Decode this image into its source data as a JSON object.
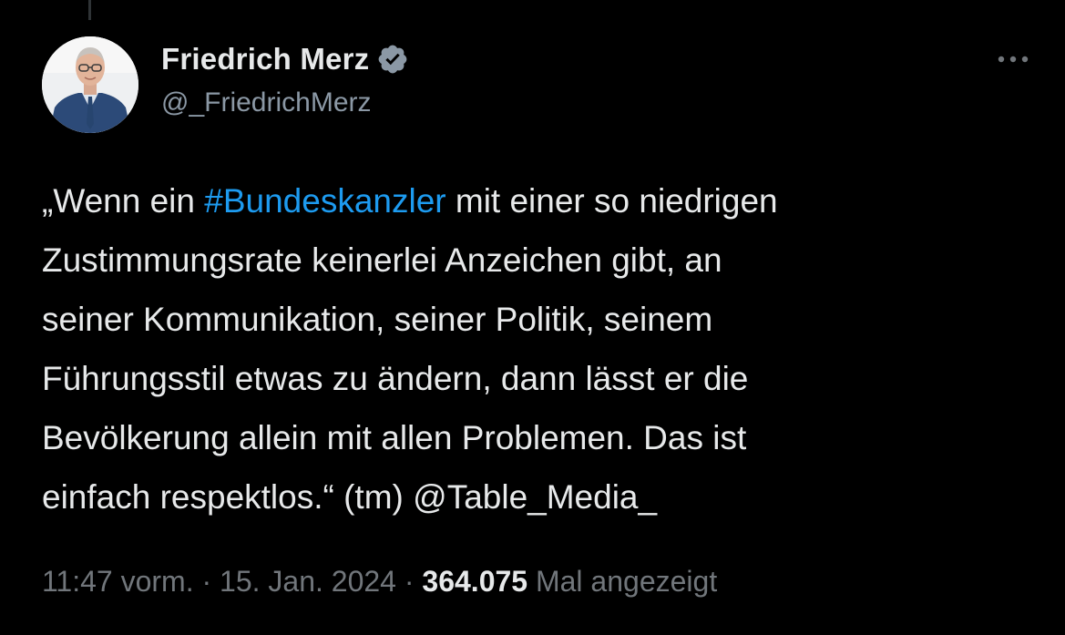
{
  "author": {
    "display_name": "Friedrich Merz",
    "handle": "@_FriedrichMerz",
    "verified": true,
    "verified_color": "#8b98a5"
  },
  "more_icon": "more-horizontal-icon",
  "tweet": {
    "lines": [
      {
        "before": "„Wenn ein ",
        "hashtag": "#Bundeskanzler",
        "after": " mit einer so niedrigen"
      },
      {
        "text": "Zustimmungsrate keinerlei Anzeichen gibt, an"
      },
      {
        "text": "seiner Kommunikation, seiner Politik, seinem"
      },
      {
        "text": "Führungsstil etwas zu ändern, dann lässt er die"
      },
      {
        "text": "Bevölkerung allein mit allen Problemen. Das ist"
      },
      {
        "before": "einfach respektlos.“ (tm) ",
        "mention": "@Table_Media_"
      }
    ]
  },
  "meta": {
    "time": "11:47 vorm.",
    "separator": "·",
    "date": "15. Jan. 2024",
    "views_count": "364.075",
    "views_label": "Mal angezeigt"
  },
  "colors": {
    "background": "#000000",
    "text": "#e7e9ea",
    "secondary": "#71767b",
    "link": "#1d9bf0"
  }
}
